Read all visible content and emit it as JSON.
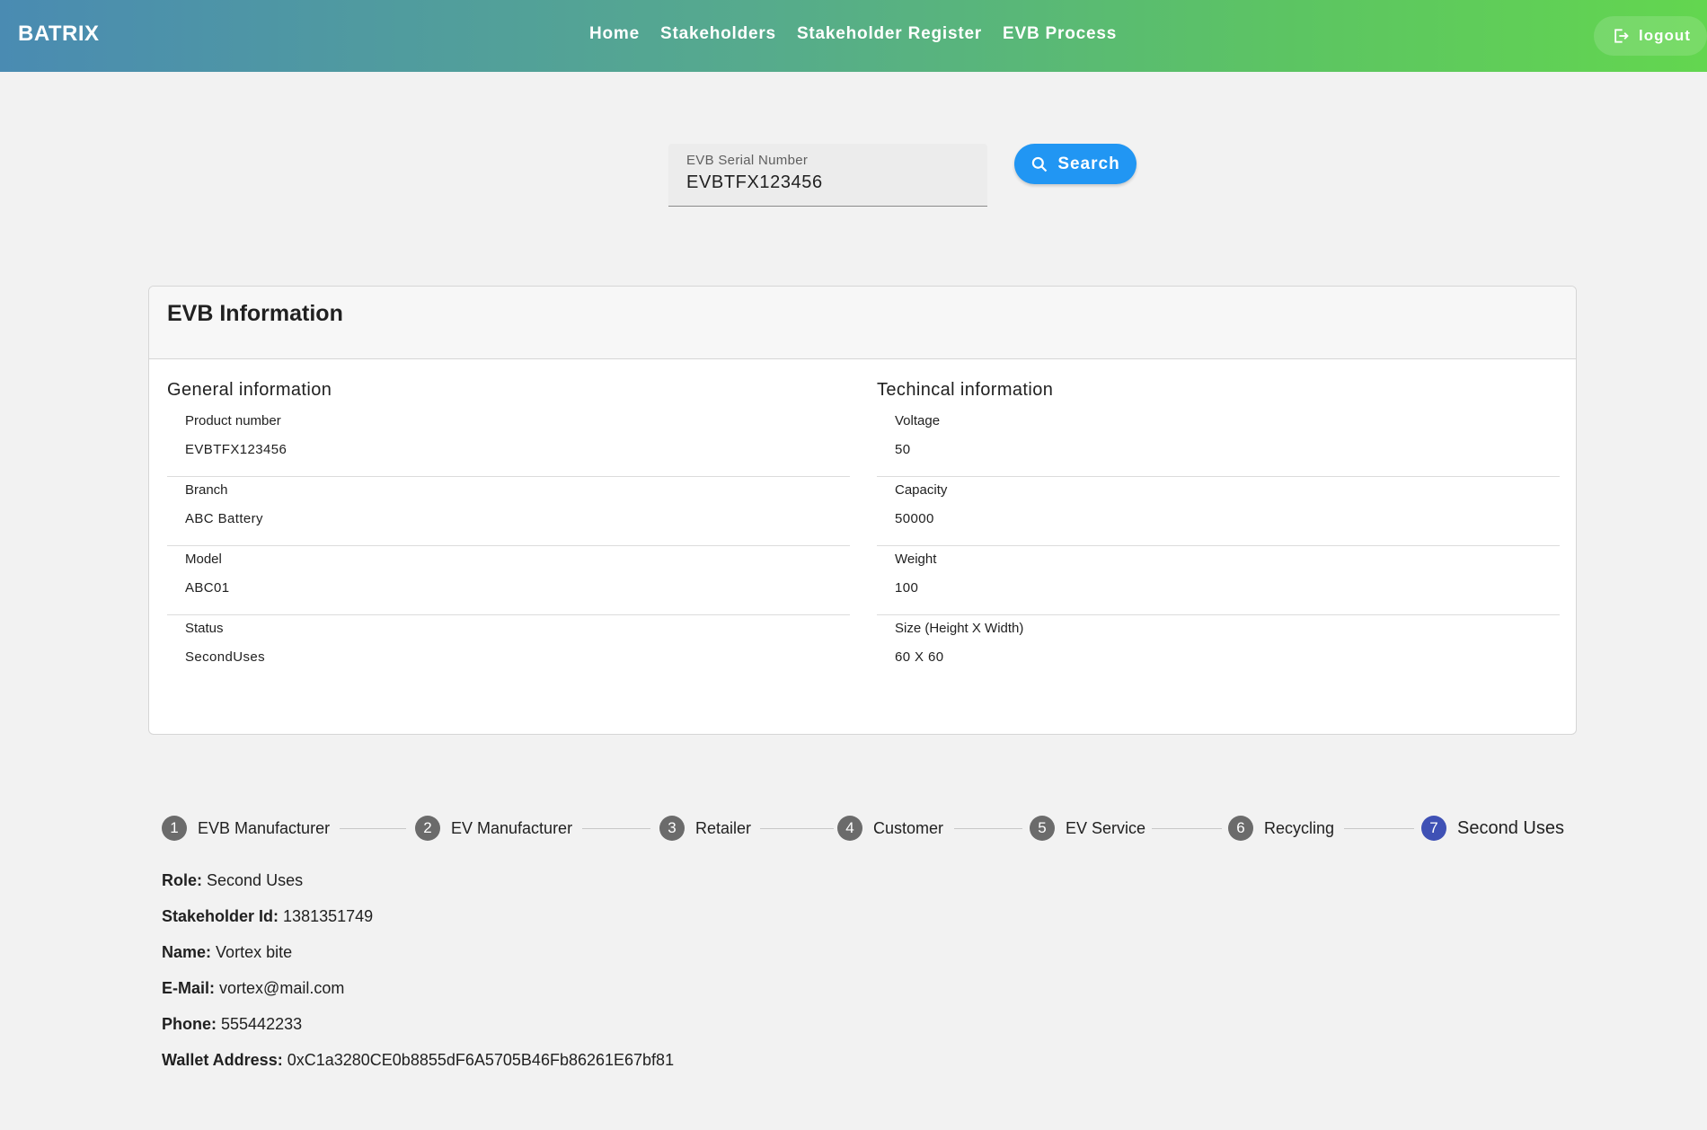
{
  "header": {
    "brand": "BATRIX",
    "nav": [
      "Home",
      "Stakeholders",
      "Stakeholder Register",
      "EVB Process"
    ],
    "logout_label": "logout"
  },
  "search": {
    "label": "EVB Serial Number",
    "value": "EVBTFX123456",
    "button_label": "Search"
  },
  "card": {
    "title": "EVB Information",
    "general": {
      "title": "General information",
      "items": [
        {
          "label": "Product number",
          "value": "EVBTFX123456"
        },
        {
          "label": "Branch",
          "value": "ABC Battery"
        },
        {
          "label": "Model",
          "value": "ABC01"
        },
        {
          "label": "Status",
          "value": "SecondUses"
        }
      ]
    },
    "technical": {
      "title": "Techincal information",
      "items": [
        {
          "label": "Voltage",
          "value": "50"
        },
        {
          "label": "Capacity",
          "value": "50000"
        },
        {
          "label": "Weight",
          "value": "100"
        },
        {
          "label": "Size (Height X Width)",
          "value": "60 X 60"
        }
      ]
    }
  },
  "stepper": {
    "active_step": 7,
    "steps": [
      {
        "num": "1",
        "label": "EVB Manufacturer"
      },
      {
        "num": "2",
        "label": "EV Manufacturer"
      },
      {
        "num": "3",
        "label": "Retailer"
      },
      {
        "num": "4",
        "label": "Customer"
      },
      {
        "num": "5",
        "label": "EV Service"
      },
      {
        "num": "6",
        "label": "Recycling"
      },
      {
        "num": "7",
        "label": "Second Uses"
      }
    ]
  },
  "details": {
    "role": {
      "label": "Role:",
      "value": "Second Uses"
    },
    "stakeholder_id": {
      "label": "Stakeholder Id:",
      "value": "1381351749"
    },
    "name": {
      "label": "Name:",
      "value": "Vortex bite"
    },
    "email": {
      "label": "E-Mail:",
      "value": "vortex@mail.com"
    },
    "phone": {
      "label": "Phone:",
      "value": "555442233"
    },
    "wallet": {
      "label": "Wallet Address:",
      "value": "0xC1a3280CE0b8855dF6A5705B46Fb86261E67bf81"
    }
  },
  "colors": {
    "primary": "#2196f3",
    "active_step": "#3f51b5",
    "header_gradient_start": "#4a8bb2",
    "header_gradient_end": "#63d64f"
  }
}
